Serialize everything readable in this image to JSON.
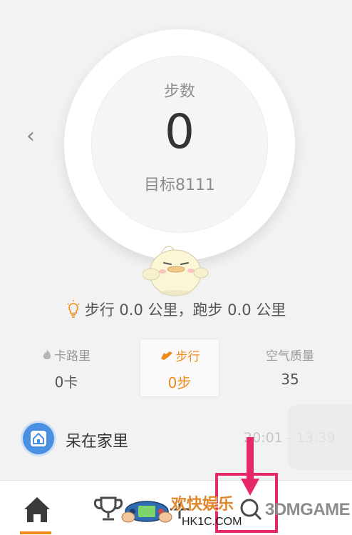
{
  "ring": {
    "label": "步数",
    "value": "0",
    "goal": "目标8111"
  },
  "summary": {
    "text": "步行 0.0 公里，跑步 0.0 公里"
  },
  "stats": {
    "calorie": {
      "label": "卡路里",
      "value": "0卡"
    },
    "steps": {
      "label": "步行",
      "value": "0步"
    },
    "air": {
      "label": "空气质量",
      "value": "35"
    }
  },
  "location": {
    "name": "呆在家里",
    "time_range": "20:01 - 13:39"
  },
  "tabbar": {
    "items": [
      {
        "icon": "home-icon"
      },
      {
        "icon": "trophy-icon"
      },
      {
        "icon": "add-icon"
      },
      {
        "icon": "search-icon"
      }
    ]
  },
  "watermarks": {
    "fun_text": "欢快娱乐",
    "site_text": "HK1C.COM",
    "brand_text": "3DMGAME"
  },
  "colors": {
    "accent": "#f08a19",
    "home_badge": "#4a90e2",
    "annotation": "#e6276a",
    "background": "#f2f2f2"
  }
}
